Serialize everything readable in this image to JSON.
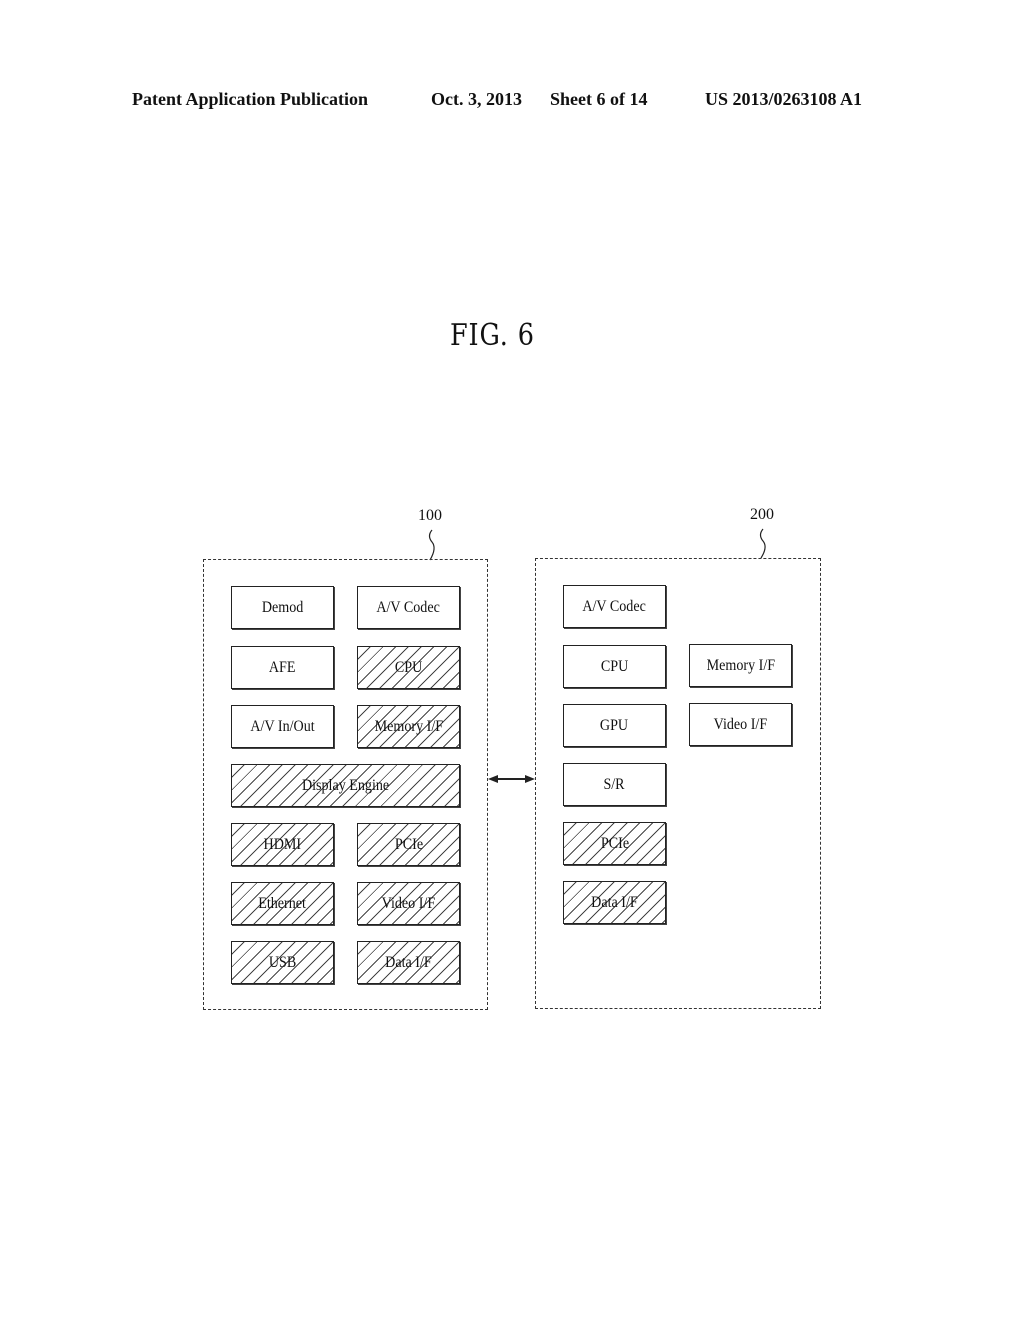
{
  "header": {
    "publication": "Patent Application Publication",
    "date": "Oct. 3, 2013",
    "sheet": "Sheet 6 of 14",
    "patent_number": "US 2013/0263108 A1"
  },
  "figure": {
    "title": "FIG. 6"
  },
  "device_100": {
    "ref": "100",
    "blocks": [
      {
        "label": "Demod",
        "hatched": false
      },
      {
        "label": "A/V Codec",
        "hatched": false
      },
      {
        "label": "AFE",
        "hatched": false
      },
      {
        "label": "CPU",
        "hatched": true
      },
      {
        "label": "A/V In/Out",
        "hatched": false
      },
      {
        "label": "Memory I/F",
        "hatched": true
      },
      {
        "label": "Display Engine",
        "hatched": true
      },
      {
        "label": "HDMI",
        "hatched": true
      },
      {
        "label": "PCIe",
        "hatched": true
      },
      {
        "label": "Ethernet",
        "hatched": true
      },
      {
        "label": "Video I/F",
        "hatched": true
      },
      {
        "label": "USB",
        "hatched": true
      },
      {
        "label": "Data I/F",
        "hatched": true
      }
    ]
  },
  "device_200": {
    "ref": "200",
    "blocks": [
      {
        "label": "A/V Codec",
        "hatched": false
      },
      {
        "label": "CPU",
        "hatched": false
      },
      {
        "label": "Memory I/F",
        "hatched": false
      },
      {
        "label": "GPU",
        "hatched": false
      },
      {
        "label": "Video I/F",
        "hatched": false
      },
      {
        "label": "S/R",
        "hatched": false
      },
      {
        "label": "PCIe",
        "hatched": true
      },
      {
        "label": "Data I/F",
        "hatched": true
      }
    ]
  },
  "connection": {
    "type": "bidirectional-arrow",
    "between": [
      "100",
      "200"
    ]
  }
}
